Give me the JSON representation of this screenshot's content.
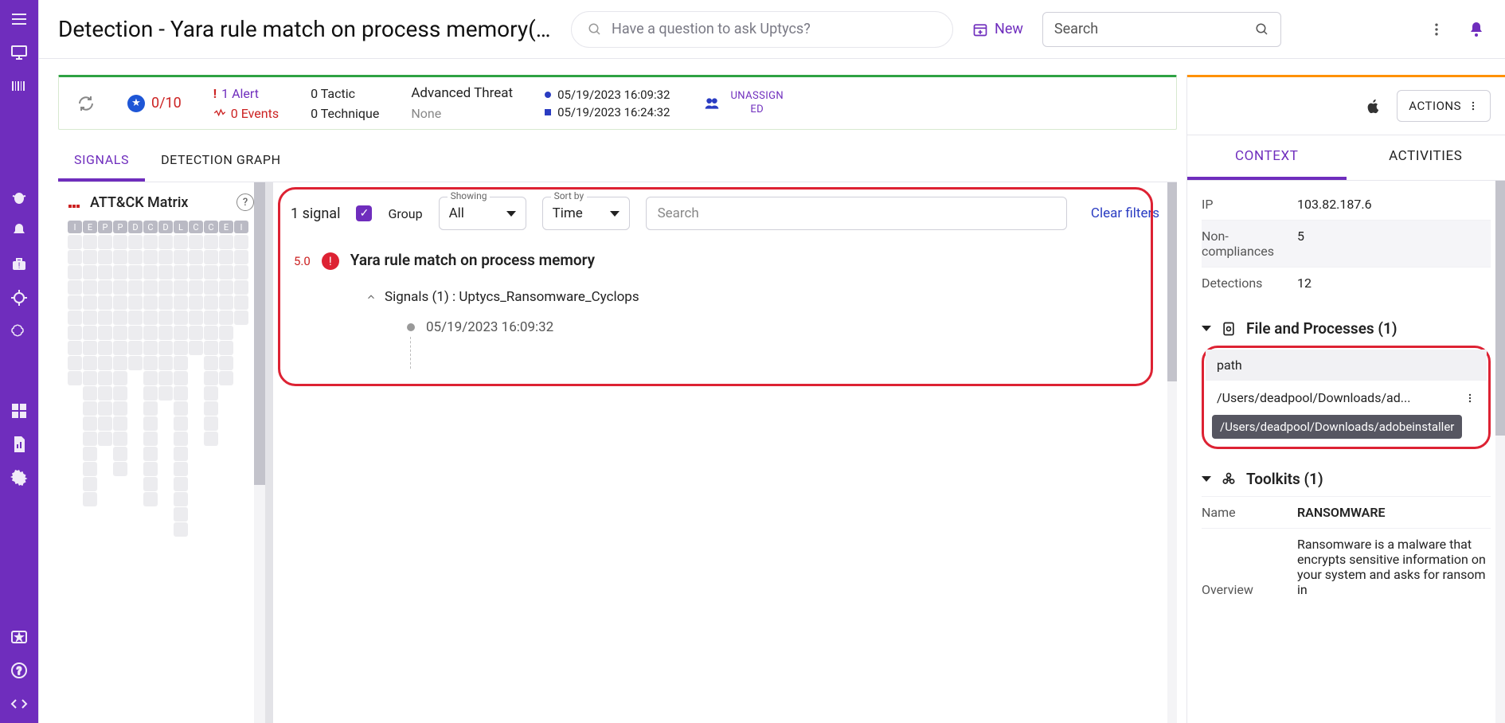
{
  "header": {
    "title": "Detection - Yara rule match on process memory(U...",
    "ask_placeholder": "Have a question to ask Uptycs?",
    "new_label": "New",
    "search_placeholder": "Search"
  },
  "info": {
    "score": "0/10",
    "alerts": "1 Alert",
    "events": "0 Events",
    "tactic": "0 Tactic",
    "technique": "0 Technique",
    "threat_label": "Advanced Threat",
    "threat_value": "None",
    "time_start": "05/19/2023 16:09:32",
    "time_end": "05/19/2023 16:24:32",
    "assign": "UNASSIGNED"
  },
  "tabs": {
    "signals": "SIGNALS",
    "graph": "DETECTION GRAPH"
  },
  "attck": {
    "title": "ATT&CK Matrix",
    "cols": [
      "I",
      "E",
      "P",
      "P",
      "D",
      "C",
      "D",
      "L",
      "C",
      "C",
      "E",
      "I"
    ]
  },
  "signals": {
    "count": "1 signal",
    "group": "Group",
    "showing_label": "Showing",
    "showing_value": "All",
    "sort_label": "Sort by",
    "sort_value": "Time",
    "search_placeholder": "Search",
    "clear": "Clear filters",
    "item": {
      "severity": "5.0",
      "name": "Yara rule match on process memory",
      "sub": "Signals (1) : Uptycs_Ransomware_Cyclops",
      "time": "05/19/2023 16:09:32"
    }
  },
  "right": {
    "actions": "ACTIONS",
    "context": "CONTEXT",
    "activities": "ACTIVITIES",
    "kv": {
      "ip_k": "IP",
      "ip_v": "103.82.187.6",
      "nc_k": "Non-compliances",
      "nc_v": "5",
      "det_k": "Detections",
      "det_v": "12"
    },
    "files_hdr": "File and Processes (1)",
    "path_hdr": "path",
    "path_short": "/Users/deadpool/Downloads/ad...",
    "path_full": "/Users/deadpool/Downloads/adobeinstaller",
    "toolkits_hdr": "Toolkits (1)",
    "name_k": "Name",
    "name_v": "RANSOMWARE",
    "overview_k": "Overview",
    "overview_v": "Ransomware is a malware that encrypts sensitive information on your system and asks for ransom in"
  }
}
